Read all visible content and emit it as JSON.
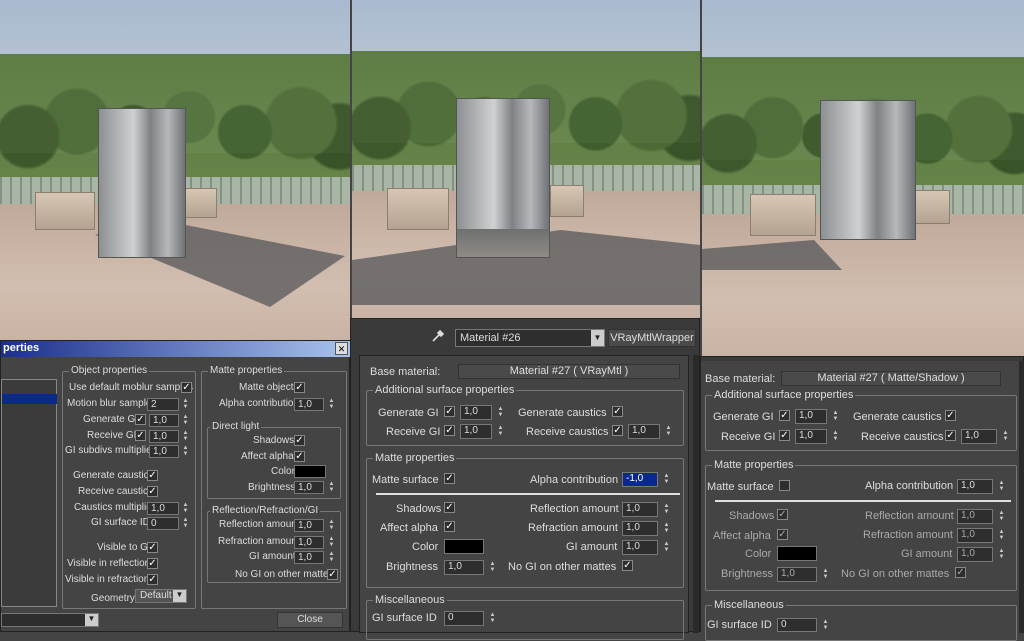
{
  "title_bar": {
    "title": "perties",
    "close_glyph": "✕"
  },
  "panel1": {
    "object_properties": {
      "title": "Object properties",
      "use_default_moblur_samples": "Use default moblur samples",
      "motion_blur_samples": "Motion blur samples",
      "motion_blur_samples_value": "2",
      "generate_gi": "Generate GI",
      "generate_gi_value": "1,0",
      "receive_gi": "Receive GI",
      "receive_gi_value": "1,0",
      "gi_subdivs_multiplier": "GI subdivs multiplier",
      "gi_subdivs_multiplier_value": "1,0",
      "generate_caustics": "Generate caustics",
      "receive_caustics": "Receive caustics",
      "caustics_multiplier": "Caustics multiplier",
      "caustics_multiplier_value": "1,0",
      "gi_surface_id": "GI surface ID",
      "gi_surface_id_value": "0",
      "visible_to_gi": "Visible to GI",
      "visible_in_reflections": "Visible in reflections",
      "visible_in_refractions": "Visible in refractions",
      "geometry": "Geometry",
      "geometry_value": "Default"
    },
    "matte_properties": {
      "title": "Matte properties",
      "matte_object": "Matte object",
      "alpha_contribution": "Alpha contribution",
      "alpha_contribution_value": "1,0",
      "direct_light": "Direct light",
      "shadows": "Shadows",
      "affect_alpha": "Affect alpha",
      "color": "Color",
      "brightness": "Brightness",
      "brightness_value": "1,0",
      "rrgi_title": "Reflection/Refraction/GI",
      "reflection_amount": "Reflection amount",
      "reflection_amount_value": "1,0",
      "refraction_amount": "Refraction amount",
      "refraction_amount_value": "1,0",
      "gi_amount": "GI amount",
      "gi_amount_value": "1,0",
      "no_gi_on_other_mattes": "No GI on other mattes"
    },
    "close_label": "Close"
  },
  "panel2": {
    "material_name": "Material #26",
    "material_type": "VRayMtlWrapper",
    "base_material_label": "Base material:",
    "base_material_value": "Material #27  ( VRayMtl )",
    "additional": {
      "title": "Additional surface properties",
      "generate_gi": "Generate GI",
      "generate_gi_value": "1,0",
      "receive_gi": "Receive GI",
      "receive_gi_value": "1,0",
      "generate_caustics": "Generate caustics",
      "receive_caustics": "Receive caustics",
      "receive_caustics_value": "1,0"
    },
    "matte": {
      "title": "Matte properties",
      "matte_surface": "Matte surface",
      "alpha_contribution": "Alpha contribution",
      "alpha_contribution_value": "-1,0",
      "shadows": "Shadows",
      "affect_alpha": "Affect alpha",
      "color": "Color",
      "brightness": "Brightness",
      "brightness_value": "1,0",
      "reflection_amount": "Reflection amount",
      "reflection_amount_value": "1,0",
      "refraction_amount": "Refraction amount",
      "refraction_amount_value": "1,0",
      "gi_amount": "GI amount",
      "gi_amount_value": "1,0",
      "no_gi_on_other_mattes": "No GI on other mattes"
    },
    "misc": {
      "title": "Miscellaneous",
      "gi_surface_id": "GI surface ID",
      "gi_surface_id_value": "0"
    }
  },
  "panel3": {
    "base_material_label": "Base material:",
    "base_material_value": "Material #27  ( Matte/Shadow )",
    "additional": {
      "title": "Additional surface properties",
      "generate_gi": "Generate GI",
      "generate_gi_value": "1,0",
      "receive_gi": "Receive GI",
      "receive_gi_value": "1,0",
      "generate_caustics": "Generate caustics",
      "receive_caustics": "Receive caustics",
      "receive_caustics_value": "1,0"
    },
    "matte": {
      "title": "Matte properties",
      "matte_surface": "Matte surface",
      "alpha_contribution": "Alpha contribution",
      "alpha_contribution_value": "1,0",
      "shadows": "Shadows",
      "affect_alpha": "Affect alpha",
      "color": "Color",
      "brightness": "Brightness",
      "brightness_value": "1,0",
      "reflection_amount": "Reflection amount",
      "reflection_amount_value": "1,0",
      "refraction_amount": "Refraction amount",
      "refraction_amount_value": "1,0",
      "gi_amount": "GI amount",
      "gi_amount_value": "1,0",
      "no_gi_on_other_mattes": "No GI on other mattes"
    },
    "misc": {
      "title": "Miscellaneous",
      "gi_surface_id": "GI surface ID",
      "gi_surface_id_value": "0"
    }
  },
  "icons": {
    "check": "✓",
    "up": "▲",
    "down": "▼",
    "dropdown": "▼",
    "eyedropper": "eyedropper-icon"
  }
}
